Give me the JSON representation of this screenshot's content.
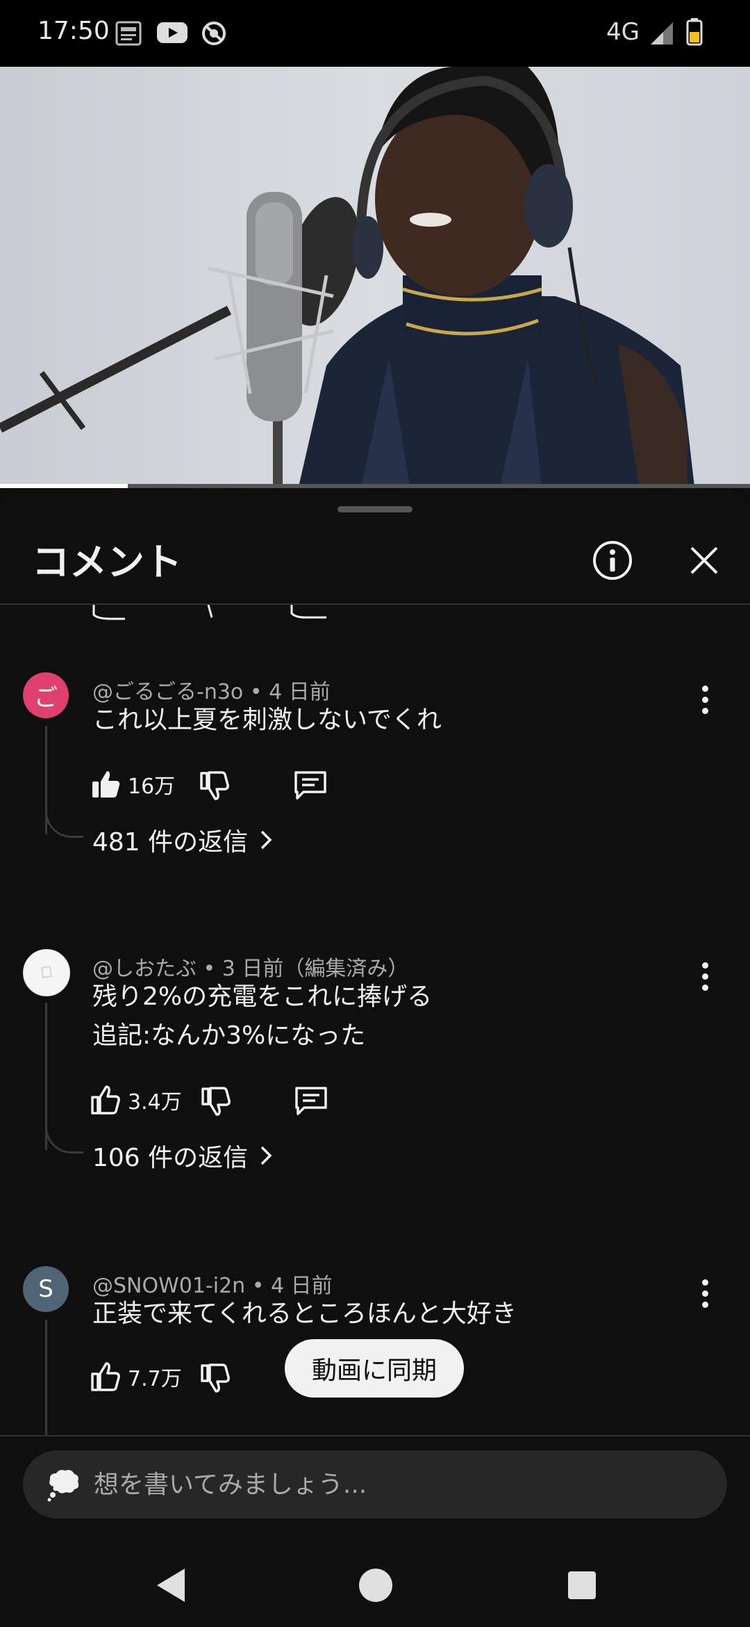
{
  "status_bar": {
    "time": "17:50",
    "network": "4G"
  },
  "video": {
    "progress_fraction": 0.17
  },
  "sheet": {
    "title": "コメント"
  },
  "comments": [
    {
      "avatar_letter": "ご",
      "avatar_color": "#e0406e",
      "author": "@ごるごる-n3o",
      "time": "4 日前",
      "text_lines": [
        "これ以上夏を刺激しないでくれ"
      ],
      "likes": "16万",
      "liked": true,
      "replies": "481 件の返信"
    },
    {
      "avatar_letter": "",
      "avatar_color": "#f5f5f5",
      "author": "@しおたぶ",
      "time": "3 日前（編集済み）",
      "text_lines": [
        "残り2%の充電をこれに捧げる",
        "追記:なんか3%になった"
      ],
      "likes": "3.4万",
      "liked": false,
      "replies": "106 件の返信"
    },
    {
      "avatar_letter": "S",
      "avatar_color": "#4f6475",
      "author": "@SNOW01-i2n",
      "time": "4 日前",
      "text_lines": [
        "正装で来てくれるところほんと大好き"
      ],
      "likes": "7.7万",
      "liked": false,
      "replies": ""
    }
  ],
  "sync_button": "動画に同期",
  "input": {
    "placeholder": "想を書いてみましょう..."
  },
  "meta_separator": "•",
  "colors": {
    "background": "#0f0f0f",
    "text": "#f1f1f1",
    "secondary": "#aaaaaa"
  }
}
